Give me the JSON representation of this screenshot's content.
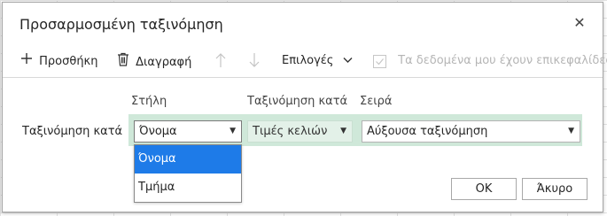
{
  "dialog": {
    "title": "Προσαρμοσμένη ταξινόμηση",
    "close_glyph": "✕"
  },
  "toolbar": {
    "add_label": "Προσθήκη",
    "delete_label": "Διαγραφή",
    "options_label": "Επιλογές",
    "headers_checkbox_label": "Τα δεδομένα μου έχουν επικεφαλίδες",
    "headers_checked": false
  },
  "columns": {
    "column_header": "Στήλη",
    "sort_on_header": "Ταξινόμηση κατά",
    "order_header": "Σειρά"
  },
  "row": {
    "label": "Ταξινόμηση κατά",
    "column_value": "Όνομα",
    "sort_on_value": "Τιμές κελιών",
    "order_value": "Αύξουσα ταξινόμηση"
  },
  "dropdown": {
    "options": [
      "Όνομα",
      "Τμήμα"
    ],
    "selected_index": 0
  },
  "buttons": {
    "ok_label": "OK",
    "cancel_label": "Άκυρο"
  },
  "colors": {
    "accent": "#1e7be8",
    "row_band": "#cfe8d9",
    "disabled_text": "#b5b5b5"
  }
}
